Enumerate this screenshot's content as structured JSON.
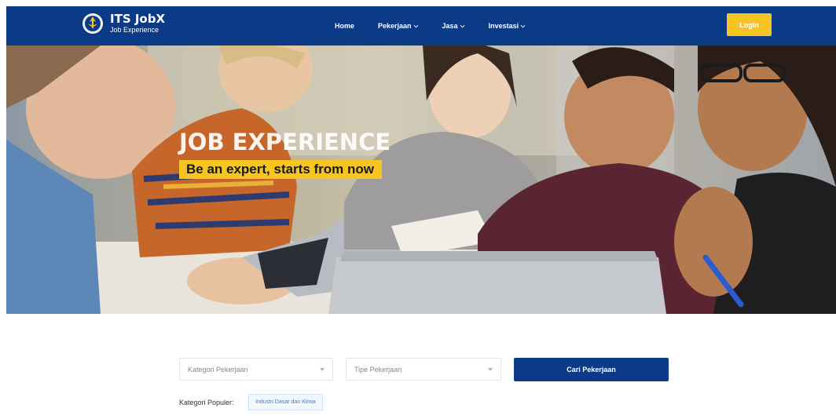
{
  "brand": {
    "title": "ITS JobX",
    "subtitle": "Job Experience"
  },
  "nav": {
    "items": [
      {
        "label": "Home",
        "dropdown": false
      },
      {
        "label": "Pekerjaan",
        "dropdown": true
      },
      {
        "label": "Jasa",
        "dropdown": true
      },
      {
        "label": "Investasi",
        "dropdown": true
      }
    ],
    "login_label": "Login"
  },
  "hero": {
    "title": "JOB EXPERIENCE",
    "tagline": "Be an expert, starts from now"
  },
  "search": {
    "category_placeholder": "Kategori Pekerjaan",
    "type_placeholder": "Tipe Pekerjaan",
    "button_label": "Cari Pekerjaan",
    "popular_label": "Kategori Populer:",
    "popular_tags": [
      "Industri Dasar dan Kimia"
    ]
  },
  "colors": {
    "navbar": "#0b3a87",
    "accent_yellow": "#f7c522",
    "button_blue": "#0b3a87",
    "tag_text": "#3a7bd5"
  },
  "icons": [
    "its-logo-icon",
    "chevron-down-icon",
    "caret-down-icon"
  ]
}
